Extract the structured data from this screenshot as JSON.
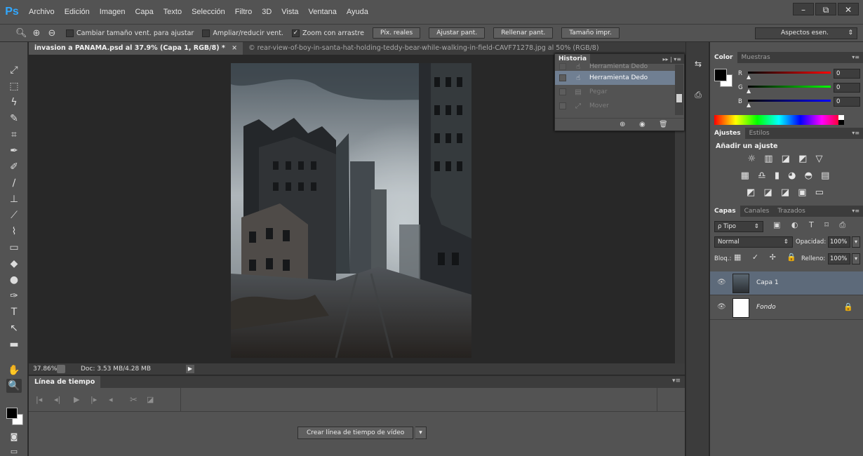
{
  "app": {
    "logo": "Ps"
  },
  "menu": [
    "Archivo",
    "Edición",
    "Imagen",
    "Capa",
    "Texto",
    "Selección",
    "Filtro",
    "3D",
    "Vista",
    "Ventana",
    "Ayuda"
  ],
  "window_controls": {
    "minimize": "–",
    "restore": "⧉",
    "close": "✕"
  },
  "options": {
    "fit_window": "Cambiar tamaño vent. para ajustar",
    "resize_window": "Ampliar/reducir vent.",
    "scrubby_zoom": "Zoom con arrastre",
    "scrubby_zoom_checked": "✓",
    "btn_actual": "Píx. reales",
    "btn_fit": "Ajustar pant.",
    "btn_fill": "Rellenar pant.",
    "btn_print": "Tamaño impr.",
    "workspace": "Aspectos esen.",
    "workspace_arrow": "⇕"
  },
  "tools": [
    "⤢",
    "⬚",
    "ϟ",
    "✎",
    "⌗",
    "✒",
    "✐",
    "∕",
    "⊥",
    "⟋",
    "⌇",
    "▭",
    "◆",
    "●",
    "✑",
    "T",
    "↖",
    "▬",
    "✋",
    "🔍"
  ],
  "doc_tabs": {
    "active": "invasion a PANAMA.psd al 37.9% (Capa 1, RGB/8) *",
    "active_close": "×",
    "inactive": "© rear-view-of-boy-in-santa-hat-holding-teddy-bear-while-walking-in-field-CAVF71278.jpg al 50% (RGB/8)"
  },
  "status": {
    "zoom": "37.86%",
    "doc": "Doc: 3.53 MB/4.28 MB",
    "arrow": "▶"
  },
  "timeline": {
    "title": "Línea de tiempo",
    "menu": "▾≡",
    "controls": [
      "|◂",
      "◂|",
      "▶",
      "|▸",
      "◂",
      "✂",
      "◪"
    ],
    "create_btn": "Crear línea de tiempo de vídeo",
    "create_arrow": "▾"
  },
  "history": {
    "title": "Historia",
    "menu": "▸▸ | ▾≡",
    "items": [
      {
        "label": "Herramienta Dedo",
        "icon": "☝",
        "state": "normal"
      },
      {
        "label": "Herramienta Dedo",
        "icon": "☝",
        "state": "selected"
      },
      {
        "label": "Pegar",
        "icon": "▤",
        "state": "dim"
      },
      {
        "label": "Mover",
        "icon": "⤢",
        "state": "dim"
      }
    ],
    "footer_icons": [
      "⊕",
      "◉",
      "🗑"
    ]
  },
  "strip_icons": [
    "⇆",
    "⎙"
  ],
  "color_panel": {
    "tabs": [
      "Color",
      "Muestras"
    ],
    "menu": "▾≡",
    "sliders": [
      {
        "label": "R",
        "value": "0"
      },
      {
        "label": "G",
        "value": "0"
      },
      {
        "label": "B",
        "value": "0"
      }
    ],
    "slider_handle": "▲"
  },
  "adjustments": {
    "tabs": [
      "Ajustes",
      "Estilos"
    ],
    "menu": "▾≡",
    "title": "Añadir un ajuste",
    "rows": [
      "☼ ▥ ◪ ◩ ▽",
      "▦ ♎ ▮ ◕ ◓ ▤",
      "◩ ◪ ◪ ▣ ▭"
    ]
  },
  "layers": {
    "tabs": [
      "Capas",
      "Canales",
      "Trazados"
    ],
    "menu": "▾≡",
    "filter": "ρ Tipo",
    "filter_arrow": "⇕",
    "filter_icons": "▣ ◐ T ⌑ ⎙",
    "blend_mode": "Normal",
    "blend_arrow": "⇕",
    "opacity_label": "Opacidad:",
    "opacity_value": "100%",
    "stepper": "▾",
    "lock_label": "Bloq.:",
    "lock_icons": "▦ ✓ ✢ 🔒",
    "fill_label": "Relleno:",
    "fill_value": "100%",
    "eye": "👁",
    "items": [
      {
        "name": "Capa 1",
        "selected": true
      },
      {
        "name": "Fondo",
        "selected": false,
        "locked": true,
        "lock": "🔒"
      }
    ]
  }
}
